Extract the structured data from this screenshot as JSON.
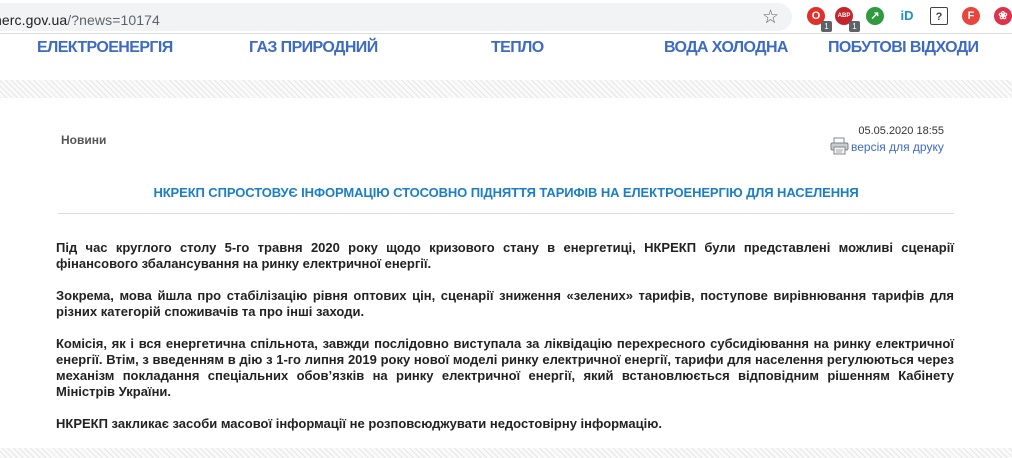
{
  "browser": {
    "url_host": "nerc.gov.ua",
    "url_path": "/?news=10174",
    "lead_glyph": "e",
    "extensions": [
      {
        "name": "opera-ext-icon",
        "color": "#e0312b",
        "glyph": "O",
        "badge": "1"
      },
      {
        "name": "adblock-ext-icon",
        "color": "#c4252b",
        "glyph": "ABP",
        "badge": "1"
      },
      {
        "name": "privat-ext-icon",
        "color": "#2f9a3f",
        "glyph": "↗",
        "badge": ""
      },
      {
        "name": "id-ext-icon",
        "color": "#1b8fd6",
        "glyph": "iD",
        "badge": ""
      },
      {
        "name": "help-ext-icon",
        "color": "#444444",
        "glyph": "?",
        "badge": ""
      },
      {
        "name": "f-ext-icon",
        "color": "#e8453c",
        "glyph": "F",
        "badge": ""
      },
      {
        "name": "brain-ext-icon",
        "color": "#e0314b",
        "glyph": "❀",
        "badge": ""
      }
    ]
  },
  "nav": {
    "items": [
      {
        "label": "ЕЛЕКТРОЕНЕРГІЯ"
      },
      {
        "label": "ГАЗ ПРИРОДНИЙ"
      },
      {
        "label": "ТЕПЛО"
      },
      {
        "label": "ВОДА ХОЛОДНА"
      },
      {
        "label": "ПОБУТОВІ ВІДХОДИ"
      }
    ]
  },
  "article": {
    "section": "Новини",
    "date": "05.05.2020 18:55",
    "print_label": "версія для друку",
    "title": "НКРЕКП СПРОСТОВУЄ ІНФОРМАЦІЮ СТОСОВНО ПІДНЯТТЯ ТАРИФІВ НА ЕЛЕКТРОЕНЕРГІЮ ДЛЯ НАСЕЛЕННЯ",
    "paragraphs": [
      "Під час круглого столу 5-го травня 2020 року щодо кризового стану в енергетиці, НКРЕКП були представлені можливі сценарії фінансового збалансування на ринку електричної енергії.",
      "Зокрема, мова йшла про стабілізацію рівня оптових цін, сценарії зниження «зелених» тарифів, поступове вирівнювання тарифів для різних категорій споживачів та про інші заходи.",
      "Комісія, як і вся енергетична спільнота, завжди послідовно виступала за ліквідацію перехресного субсидіювання на ринку електричної енергії.  Втім, з введенням в дію з 1-го липня 2019 року нової моделі ринку електричної енергії, тарифи для населення регулюються через механізм покладання спеціальних обов’язків на ринку електричної енергії, який встановлюється відповідним рішенням Кабінету Міністрів України.",
      "НКРЕКП закликає засоби масової інформації не розповсюджувати недостовірну інформацію."
    ]
  }
}
